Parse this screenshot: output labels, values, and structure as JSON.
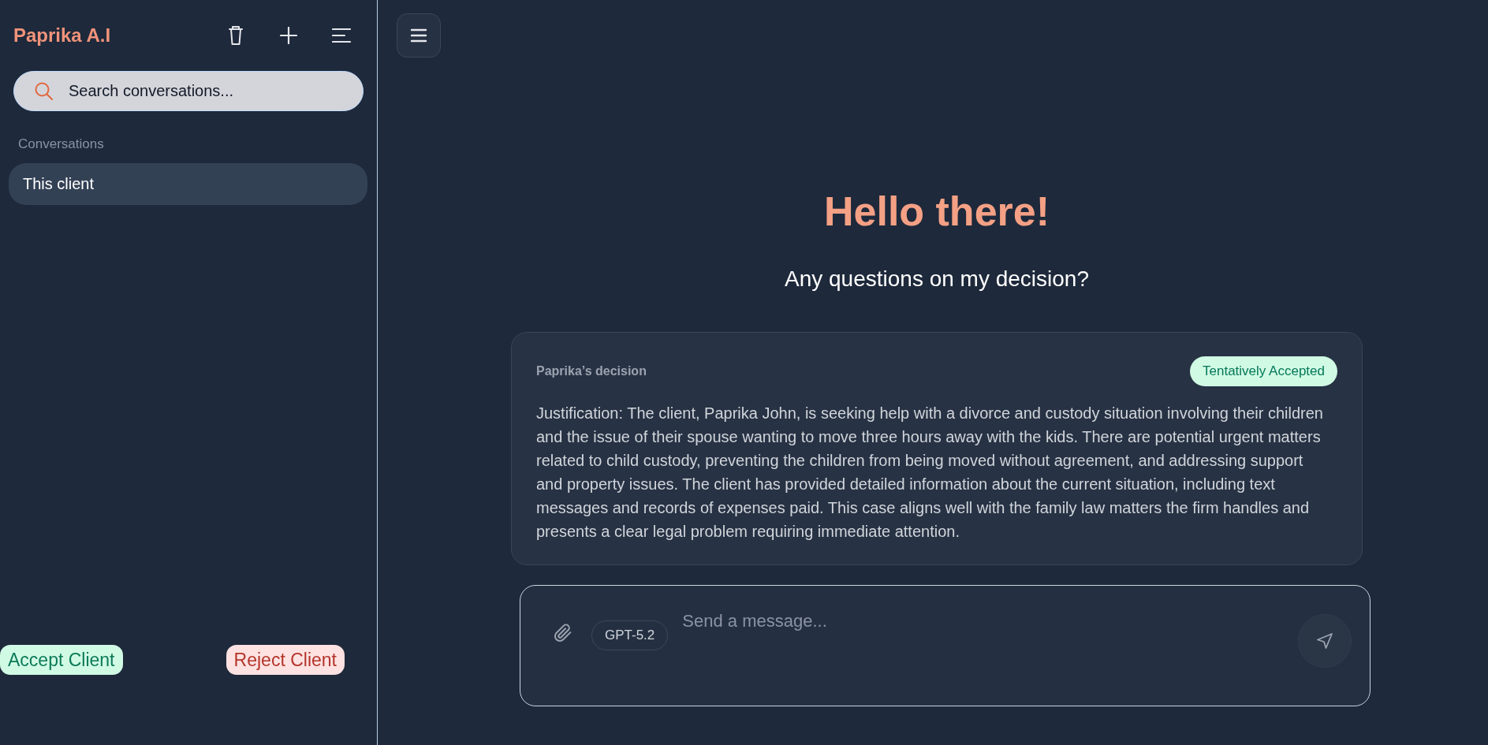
{
  "sidebar": {
    "title": "Paprika A.I",
    "search": {
      "placeholder": "Search conversations..."
    },
    "section_label": "Conversations",
    "conversations": [
      {
        "title": "This client",
        "selected": true
      }
    ],
    "actions": [
      {
        "label": "Accept Client",
        "kind": "accept"
      },
      {
        "label": "Reject Client",
        "kind": "reject"
      }
    ]
  },
  "main": {
    "heading": "Hello there!",
    "subheading": "Any questions on my decision?",
    "decision": {
      "label": "Paprika’s decision",
      "status": {
        "label": "Tentatively Accepted",
        "kind": "accepted"
      },
      "text": "Justification: The client, Paprika John, is seeking help with a divorce and custody situation involving their children and the issue of their spouse wanting to move three hours away with the kids. There are potential urgent matters related to child custody, preventing the children from being moved without agreement, and addressing support and property issues. The client has provided detailed information about the current situation, including text messages and records of expenses paid. This case aligns well with the family law matters the firm handles and presents a clear legal problem requiring immediate attention."
    },
    "composer": {
      "model": "GPT-5.2",
      "placeholder": "Send a message..."
    }
  }
}
